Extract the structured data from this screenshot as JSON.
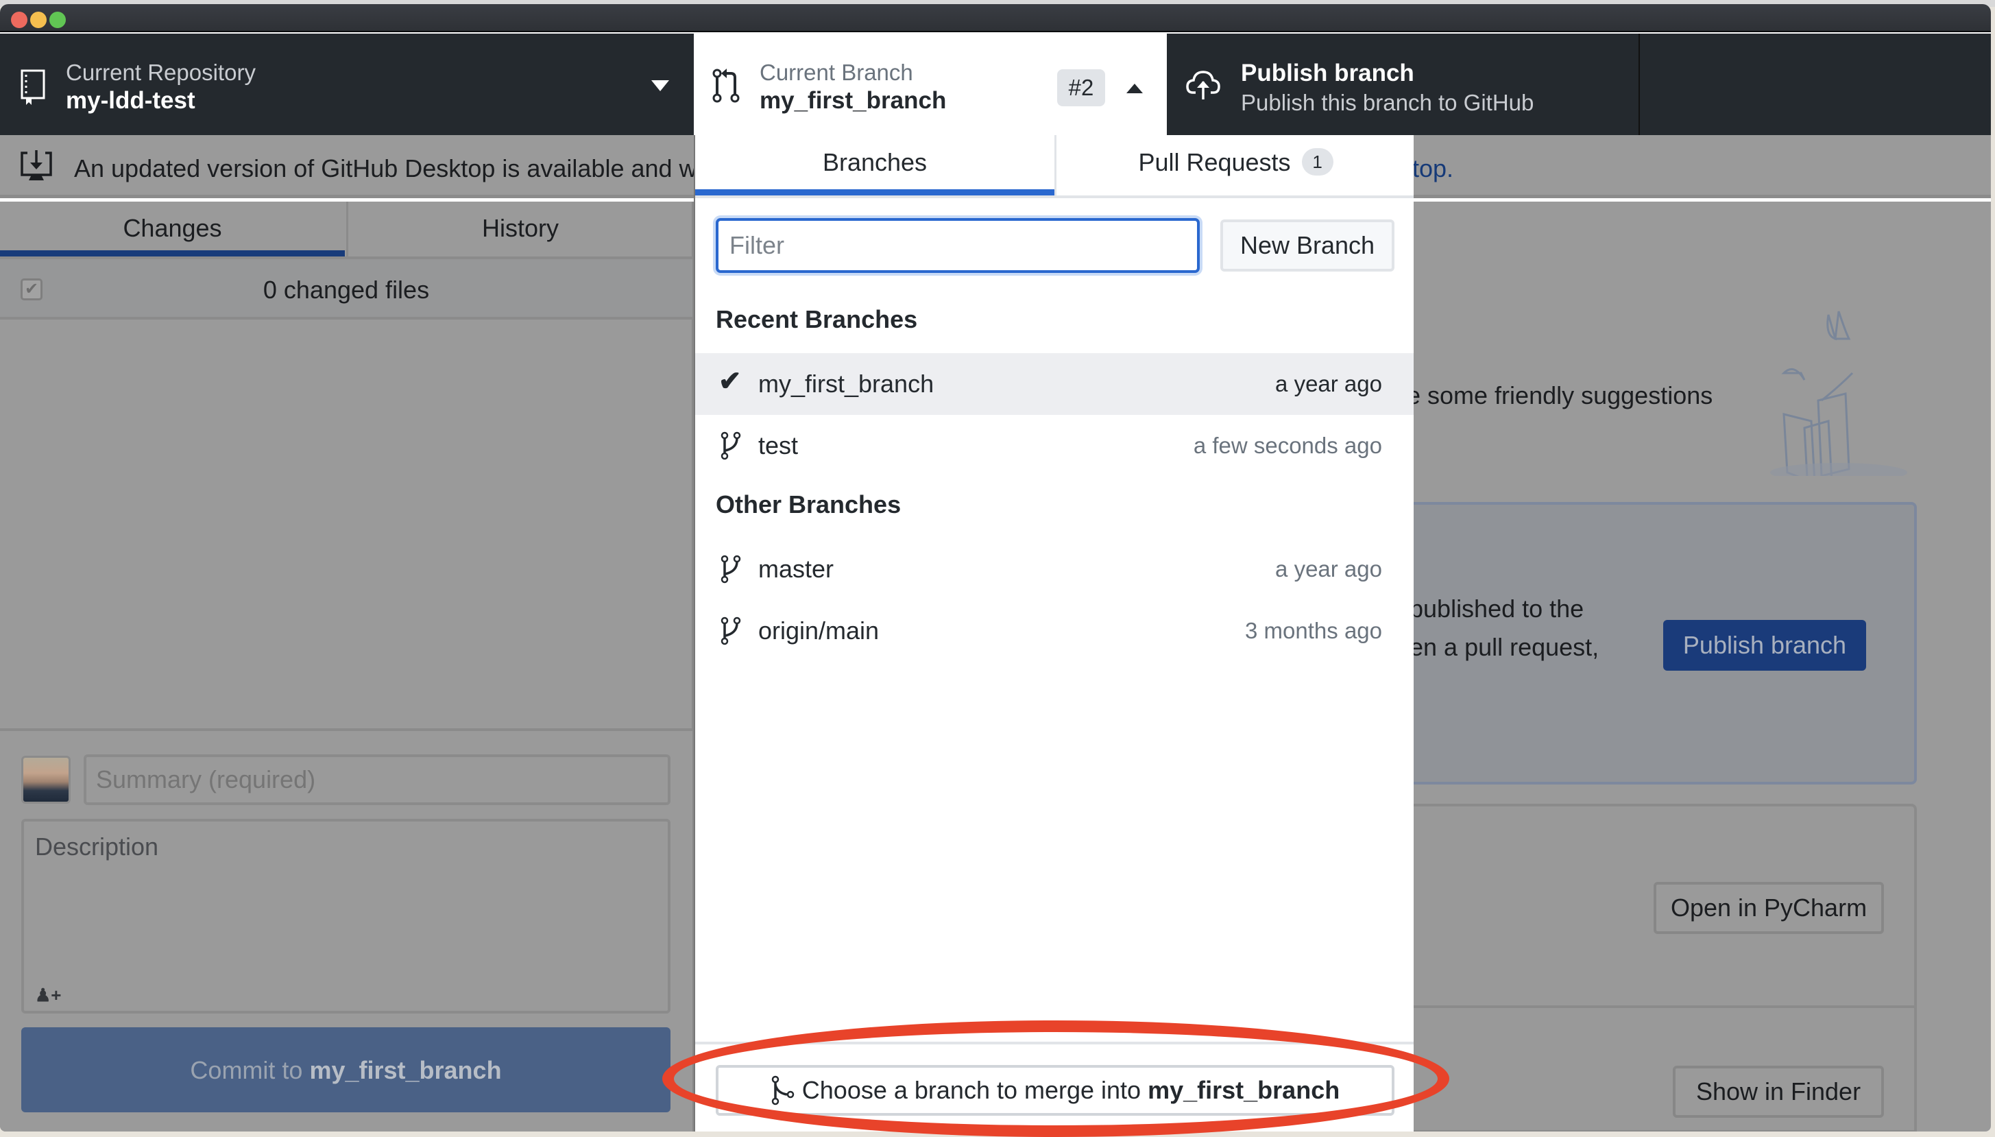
{
  "window": {
    "traffic_lights": [
      "close",
      "minimize",
      "zoom"
    ]
  },
  "toolbar": {
    "repository": {
      "label": "Current Repository",
      "value": "my-ldd-test",
      "icon": "repo-icon"
    },
    "branch": {
      "label": "Current Branch",
      "value": "my_first_branch",
      "pr_badge": "#2",
      "icon": "pull-request-icon"
    },
    "publish": {
      "title": "Publish branch",
      "subtitle": "Publish this branch to GitHub",
      "icon": "cloud-upload-icon"
    }
  },
  "banner": {
    "text": "An updated version of GitHub Desktop is available and will b",
    "link_fragment": "top."
  },
  "sidebar": {
    "tabs": [
      {
        "label": "Changes",
        "selected": true
      },
      {
        "label": "History",
        "selected": false
      }
    ],
    "changed_files": "0 changed files",
    "summary_placeholder": "Summary (required)",
    "description_placeholder": "Description",
    "commit_button": {
      "prefix": "Commit to ",
      "branch": "my_first_branch"
    }
  },
  "main": {
    "suggestions_text": "e some friendly suggestions",
    "publish_card": {
      "line1": "published to the",
      "line2": "en a pull request,",
      "button": "Publish branch"
    },
    "open_in_editor_button": "Open in PyCharm",
    "show_in_finder_button": "Show in Finder"
  },
  "branch_dropdown": {
    "tabs": [
      {
        "label": "Branches",
        "selected": true
      },
      {
        "label": "Pull Requests",
        "count": "1",
        "selected": false
      }
    ],
    "filter_placeholder": "Filter",
    "new_branch_button": "New Branch",
    "groups": [
      {
        "header": "Recent Branches",
        "branches": [
          {
            "name": "my_first_branch",
            "time": "a year ago",
            "current": true
          },
          {
            "name": "test",
            "time": "a few seconds ago",
            "current": false
          }
        ]
      },
      {
        "header": "Other Branches",
        "branches": [
          {
            "name": "master",
            "time": "a year ago",
            "current": false
          },
          {
            "name": "origin/main",
            "time": "3 months ago",
            "current": false
          }
        ]
      }
    ],
    "merge_button": {
      "prefix": "Choose a branch to merge into ",
      "branch": "my_first_branch"
    }
  },
  "annotation": {
    "shape": "ellipse",
    "color": "#e8432a",
    "target": "merge-button"
  },
  "colors": {
    "toolbar_bg": "#24292e",
    "accent_blue": "#2a68cf",
    "annotation_red": "#e8432a"
  }
}
